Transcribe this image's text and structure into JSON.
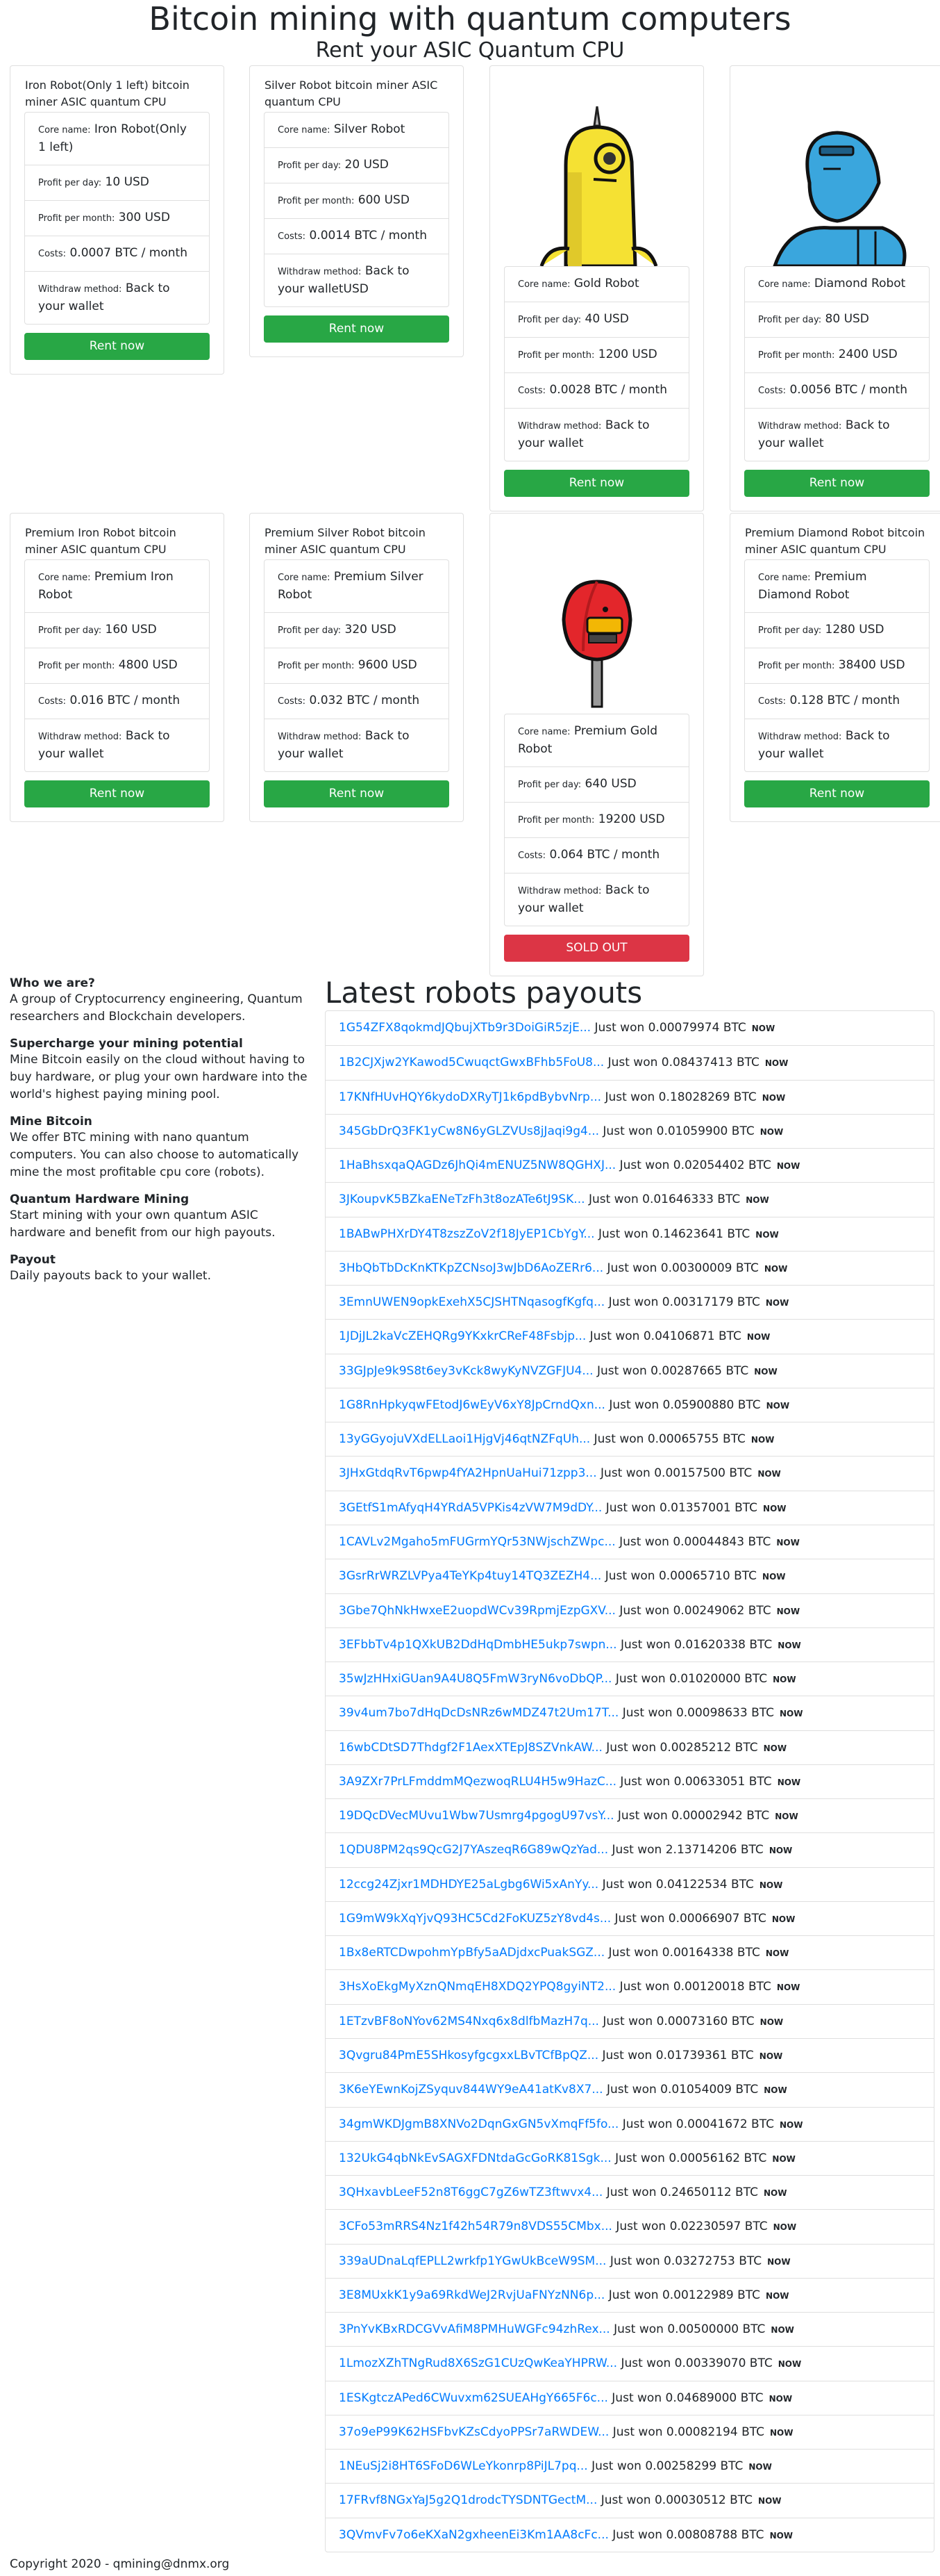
{
  "header": {
    "title": "Bitcoin mining with quantum computers",
    "subtitle": "Rent your ASIC Quantum CPU"
  },
  "labels": {
    "core_name": "Core name:",
    "profit_day": "Profit per day:",
    "profit_month": "Profit per month:",
    "costs": "Costs:",
    "withdraw": "Withdraw method:"
  },
  "robots": [
    {
      "name": "Iron Robot(Only 1 left) bitcoin miner ASIC quantum CPU",
      "core": "Iron Robot(Only 1 left)",
      "day": "10 USD",
      "month": "300 USD",
      "costs": "0.0007 BTC / month",
      "withdraw": "Back to your wallet",
      "button": "Rent now"
    },
    {
      "name": "Silver Robot bitcoin miner ASIC quantum CPU",
      "core": "Silver Robot",
      "day": "20 USD",
      "month": "600 USD",
      "costs": "0.0014 BTC / month",
      "withdraw": "Back to your walletUSD",
      "button": "Rent now"
    },
    {
      "name": "",
      "image": "gold-robot",
      "core": "Gold Robot",
      "day": "40 USD",
      "month": "1200 USD",
      "costs": "0.0028 BTC / month",
      "withdraw": "Back to your wallet",
      "button": "Rent now"
    },
    {
      "name": "",
      "image": "diamond-robot",
      "core": "Diamond Robot",
      "day": "80 USD",
      "month": "2400 USD",
      "costs": "0.0056 BTC / month",
      "withdraw": "Back to your wallet",
      "button": "Rent now"
    },
    {
      "name": "Premium Iron Robot bitcoin miner ASIC quantum CPU",
      "core": "Premium Iron Robot",
      "day": "160 USD",
      "month": "4800 USD",
      "costs": "0.016 BTC / month",
      "withdraw": "Back to your wallet",
      "button": "Rent now"
    },
    {
      "name": "Premium Silver Robot bitcoin miner ASIC quantum CPU",
      "core": "Premium Silver Robot",
      "day": "320 USD",
      "month": "9600 USD",
      "costs": "0.032 BTC / month",
      "withdraw": "Back to your wallet",
      "button": "Rent now"
    },
    {
      "name": "",
      "image": "premium-gold-robot",
      "core": "Premium Gold Robot",
      "day": "640 USD",
      "month": "19200 USD",
      "costs": "0.064 BTC / month",
      "withdraw": "Back to your wallet",
      "button": "SOLD OUT"
    },
    {
      "name": "Premium Diamond Robot bitcoin miner ASIC quantum CPU",
      "core": "Premium Diamond Robot",
      "day": "1280 USD",
      "month": "38400 USD",
      "costs": "0.128 BTC / month",
      "withdraw": "Back to your wallet",
      "button": "Rent now"
    }
  ],
  "info": [
    {
      "heading": "Who we are?",
      "text": "A group of Cryptocurrency engineering, Quantum researchers and Blockchain developers."
    },
    {
      "heading": "Supercharge your mining potential",
      "text": "Mine Bitcoin easily on the cloud without having to buy hardware, or plug your own hardware into the world's highest paying mining pool."
    },
    {
      "heading": "Mine Bitcoin",
      "text": "We offer BTC mining with nano quantum computers. You can also choose to automatically mine the most profitable cpu core (robots)."
    },
    {
      "heading": "Quantum Hardware Mining",
      "text": "Start mining with your own quantum ASIC hardware and benefit from our high payouts."
    },
    {
      "heading": "Payout",
      "text": "Daily payouts back to your wallet."
    }
  ],
  "payouts": {
    "title": "Latest robots payouts",
    "won_prefix": "Just won",
    "badge": "NOW",
    "items": [
      {
        "address": "1G54ZFX8qokmdJQbujXTb9r3DoiGiR5zjE...",
        "amount": "0.00079974 BTC"
      },
      {
        "address": "1B2CJXjw2YKawod5CwuqctGwxBFhb5FoU8...",
        "amount": "0.08437413 BTC"
      },
      {
        "address": "17KNfHUvHQY6kydoDXRyTJ1k6pdBybvNrp...",
        "amount": "0.18028269 BTC"
      },
      {
        "address": "345GbDrQ3FK1yCw8N6yGLZVUs8jJaqi9g4...",
        "amount": "0.01059900 BTC"
      },
      {
        "address": "1HaBhsxqaQAGDz6JhQi4mENUZ5NW8QGHXJ...",
        "amount": "0.02054402 BTC"
      },
      {
        "address": "3JKoupvK5BZkaENeTzFh3t8ozATe6tJ9SK...",
        "amount": "0.01646333 BTC"
      },
      {
        "address": "1BABwPHXrDY4T8zszZoV2f18JyEP1CbYgY...",
        "amount": "0.14623641 BTC"
      },
      {
        "address": "3HbQbTbDcKnKTKpZCNsoJ3wJbD6AoZERr6...",
        "amount": "0.00300009 BTC"
      },
      {
        "address": "3EmnUWEN9opkExehX5CJSHTNqasogfKgfq...",
        "amount": "0.00317179 BTC"
      },
      {
        "address": "1JDjJL2kaVcZEHQRg9YKxkrCReF48Fsbjp...",
        "amount": "0.04106871 BTC"
      },
      {
        "address": "33GJpJe9k9S8t6ey3vKck8wyKyNVZGFJU4...",
        "amount": "0.00287665 BTC"
      },
      {
        "address": "1G8RnHpkyqwFEtodJ6wEyV6xY8JpCrndQxn...",
        "amount": "0.05900880 BTC"
      },
      {
        "address": "13yGGyojuVXdELLaoi1HjgVj46qtNZFqUh...",
        "amount": "0.00065755 BTC"
      },
      {
        "address": "3JHxGtdqRvT6pwp4fYA2HpnUaHui71zpp3...",
        "amount": "0.00157500 BTC"
      },
      {
        "address": "3GEtfS1mAfyqH4YRdA5VPKis4zVW7M9dDY...",
        "amount": "0.01357001 BTC"
      },
      {
        "address": "1CAVLv2Mgaho5mFUGrmYQr53NWjschZWpc...",
        "amount": "0.00044843 BTC"
      },
      {
        "address": "3GsrRrWRZLVPya4TeYKp4tuy14TQ3ZEZH4...",
        "amount": "0.00065710 BTC"
      },
      {
        "address": "3Gbe7QhNkHwxeE2uopdWCv39RpmjEzpGXV...",
        "amount": "0.00249062 BTC"
      },
      {
        "address": "3EFbbTv4p1QXkUB2DdHqDmbHE5ukp7swpn...",
        "amount": "0.01620338 BTC"
      },
      {
        "address": "35wJzHHxiGUan9A4U8Q5FmW3ryN6voDbQP...",
        "amount": "0.01020000 BTC"
      },
      {
        "address": "39v4um7bo7dHqDcDsNRz6wMDZ47t2Um17T...",
        "amount": "0.00098633 BTC"
      },
      {
        "address": "16wbCDtSD7Thdgf2F1AexXTEpJ8SZVnkAW...",
        "amount": "0.00285212 BTC"
      },
      {
        "address": "3A9ZXr7PrLFmddmMQezwoqRLU4H5w9HazC...",
        "amount": "0.00633051 BTC"
      },
      {
        "address": "19DQcDVecMUvu1Wbw7Usmrg4pgogU97vsY...",
        "amount": "0.00002942 BTC"
      },
      {
        "address": "1QDU8PM2qs9QcG2J7YAszeqR6G89wQzYad...",
        "amount": "2.13714206 BTC"
      },
      {
        "address": "12ccg24Zjxr1MDHDYE25aLgbg6Wi5xAnYy...",
        "amount": "0.04122534 BTC"
      },
      {
        "address": "1G9mW9kXqYjvQ93HC5Cd2FoKUZ5zY8vd4s...",
        "amount": "0.00066907 BTC"
      },
      {
        "address": "1Bx8eRTCDwpohmYpBfy5aADjdxcPuakSGZ...",
        "amount": "0.00164338 BTC"
      },
      {
        "address": "3HsXoEkgMyXznQNmqEH8XDQ2YPQ8gyiNT2...",
        "amount": "0.00120018 BTC"
      },
      {
        "address": "1ETzvBF8oNYov62MS4Nxq6x8dlfbMazH7q...",
        "amount": "0.00073160 BTC"
      },
      {
        "address": "3Qvgru84PmE5SHkosyfgcgxxLBvTCfBpQZ...",
        "amount": "0.01739361 BTC"
      },
      {
        "address": "3K6eYEwnKojZSyquv844WY9eA41atKv8X7...",
        "amount": "0.01054009 BTC"
      },
      {
        "address": "34gmWKDJgmB8XNVo2DqnGxGN5vXmqFf5fo...",
        "amount": "0.00041672 BTC"
      },
      {
        "address": "132UkG4qbNkEvSAGXFDNtdaGcGoRK81Sgk...",
        "amount": "0.00056162 BTC"
      },
      {
        "address": "3QHxavbLeeF52n8T6ggC7gZ6wTZ3ftwvx4...",
        "amount": "0.24650112 BTC"
      },
      {
        "address": "3CFo53mRRS4Nz1f42h54R79n8VDS55CMbx...",
        "amount": "0.02230597 BTC"
      },
      {
        "address": "339aUDnaLqfEPLL2wrkfp1YGwUkBceW9SM...",
        "amount": "0.03272753 BTC"
      },
      {
        "address": "3E8MUxkK1y9a69RkdWeJ2RvjUaFNYzNN6p...",
        "amount": "0.00122989 BTC"
      },
      {
        "address": "3PnYvKBxRDCGVvAfiM8PMHuWGFc94zhRex...",
        "amount": "0.00500000 BTC"
      },
      {
        "address": "1LmozXZhTNgRud8X6SzG1CUzQwKeaYHPRW...",
        "amount": "0.00339070 BTC"
      },
      {
        "address": "1ESKgtczAPed6CWuvxm62SUEAHgY665F6c...",
        "amount": "0.04689000 BTC"
      },
      {
        "address": "37o9eP99K62HSFbvKZsCdyoPPSr7aRWDEW...",
        "amount": "0.00082194 BTC"
      },
      {
        "address": "1NEuSj2i8HT6SFoD6WLeYkonrp8PiJL7pq...",
        "amount": "0.00258299 BTC"
      },
      {
        "address": "17FRvf8NGxYaJ5g2Q1drodcTYSDNTGectM...",
        "amount": "0.00030512 BTC"
      },
      {
        "address": "3QVmvFv7o6eKXaN2gxheenEi3Km1AA8cFc...",
        "amount": "0.00808788 BTC"
      }
    ]
  },
  "footer": {
    "copyright": "Copyright 2020 - qmining@dnmx.org"
  },
  "colors": {
    "link": "#007bff",
    "rent_button": "#28a745",
    "soldout_button": "#dc3545",
    "gold_robot": "#f5e133",
    "diamond_robot": "#3aa6dd",
    "premium_gold_robot": "#e3262b"
  }
}
